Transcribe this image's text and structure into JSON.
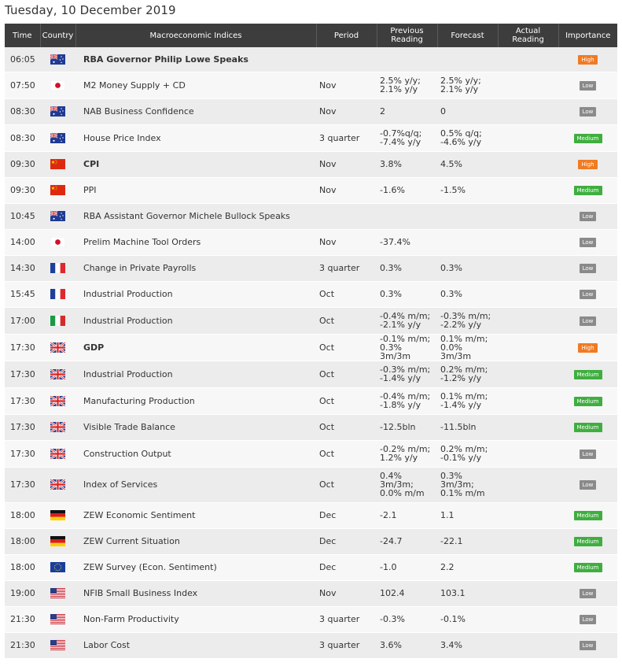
{
  "page_title": "Tuesday, 10 December 2019",
  "headers": [
    "Time",
    "Country",
    "Macroeconomic Indices",
    "Period",
    "Previous Reading",
    "Forecast",
    "Actual Reading",
    "Importance"
  ],
  "colors": {
    "header_bg": "#3d3d3d",
    "high": "#f07b23",
    "low": "#8a8a8a",
    "medium": "#3fae3f"
  },
  "rows": [
    {
      "time": "06:05",
      "country": "au",
      "flag_icon": "australia-flag-icon",
      "name": "RBA Governor Philip Lowe Speaks",
      "bold": true,
      "period": "",
      "previous": "",
      "forecast": "",
      "actual": "",
      "importance": "High"
    },
    {
      "time": "07:50",
      "country": "jp",
      "flag_icon": "japan-flag-icon",
      "name": "M2 Money Supply + CD",
      "bold": false,
      "period": "Nov",
      "previous": "2.5% y/y;\n2.1% y/y",
      "forecast": "2.5% y/y;\n2.1% y/y",
      "actual": "",
      "importance": "Low"
    },
    {
      "time": "08:30",
      "country": "au",
      "flag_icon": "australia-flag-icon",
      "name": "NAB Business Confidence",
      "bold": false,
      "period": "Nov",
      "previous": "2",
      "forecast": "0",
      "actual": "",
      "importance": "Low"
    },
    {
      "time": "08:30",
      "country": "au",
      "flag_icon": "australia-flag-icon",
      "name": "House Price Index",
      "bold": false,
      "period": "3 quarter",
      "previous": "-0.7%q/q;\n-7.4% y/y",
      "forecast": "0.5% q/q;\n-4.6% y/y",
      "actual": "",
      "importance": "Medium"
    },
    {
      "time": "09:30",
      "country": "cn",
      "flag_icon": "china-flag-icon",
      "name": "CPI",
      "bold": true,
      "period": "Nov",
      "previous": "3.8%",
      "forecast": "4.5%",
      "actual": "",
      "importance": "High"
    },
    {
      "time": "09:30",
      "country": "cn",
      "flag_icon": "china-flag-icon",
      "name": "PPI",
      "bold": false,
      "period": "Nov",
      "previous": "-1.6%",
      "forecast": "-1.5%",
      "actual": "",
      "importance": "Medium"
    },
    {
      "time": "10:45",
      "country": "au",
      "flag_icon": "australia-flag-icon",
      "name": "RBA Assistant Governor Michele Bullock Speaks",
      "bold": false,
      "period": "",
      "previous": "",
      "forecast": "",
      "actual": "",
      "importance": "Low"
    },
    {
      "time": "14:00",
      "country": "jp",
      "flag_icon": "japan-flag-icon",
      "name": "Prelim Machine Tool Orders",
      "bold": false,
      "period": "Nov",
      "previous": "-37.4%",
      "forecast": "",
      "actual": "",
      "importance": "Low"
    },
    {
      "time": "14:30",
      "country": "fr",
      "flag_icon": "france-flag-icon",
      "name": "Change in Private Payrolls",
      "bold": false,
      "period": "3 quarter",
      "previous": "0.3%",
      "forecast": "0.3%",
      "actual": "",
      "importance": "Low"
    },
    {
      "time": "15:45",
      "country": "fr",
      "flag_icon": "france-flag-icon",
      "name": "Industrial Production",
      "bold": false,
      "period": "Oct",
      "previous": "0.3%",
      "forecast": "0.3%",
      "actual": "",
      "importance": "Low"
    },
    {
      "time": "17:00",
      "country": "it",
      "flag_icon": "italy-flag-icon",
      "name": "Industrial Production",
      "bold": false,
      "period": "Oct",
      "previous": "-0.4% m/m;\n-2.1% y/y",
      "forecast": "-0.3% m/m;\n-2.2% y/y",
      "actual": "",
      "importance": "Low"
    },
    {
      "time": "17:30",
      "country": "uk",
      "flag_icon": "uk-flag-icon",
      "name": "GDP",
      "bold": true,
      "period": "Oct",
      "previous": "-0.1% m/m;\n0.3% 3m/3m",
      "forecast": "0.1% m/m;\n0.0% 3m/3m",
      "actual": "",
      "importance": "High"
    },
    {
      "time": "17:30",
      "country": "uk",
      "flag_icon": "uk-flag-icon",
      "name": "Industrial Production",
      "bold": false,
      "period": "Oct",
      "previous": "-0.3% m/m;\n-1.4% y/y",
      "forecast": "0.2% m/m;\n-1.2% y/y",
      "actual": "",
      "importance": "Medium"
    },
    {
      "time": "17:30",
      "country": "uk",
      "flag_icon": "uk-flag-icon",
      "name": "Manufacturing Production",
      "bold": false,
      "period": "Oct",
      "previous": "-0.4% m/m;\n-1.8% y/y",
      "forecast": "0.1% m/m;\n-1.4% y/y",
      "actual": "",
      "importance": "Medium"
    },
    {
      "time": "17:30",
      "country": "uk",
      "flag_icon": "uk-flag-icon",
      "name": "Visible Trade Balance",
      "bold": false,
      "period": "Oct",
      "previous": "-12.5bln",
      "forecast": "-11.5bln",
      "actual": "",
      "importance": "Medium"
    },
    {
      "time": "17:30",
      "country": "uk",
      "flag_icon": "uk-flag-icon",
      "name": "Construction Output",
      "bold": false,
      "period": "Oct",
      "previous": "-0.2% m/m;\n1.2% y/y",
      "forecast": "0.2% m/m;\n-0.1% y/y",
      "actual": "",
      "importance": "Low"
    },
    {
      "time": "17:30",
      "country": "uk",
      "flag_icon": "uk-flag-icon",
      "name": "Index of Services",
      "bold": false,
      "period": "Oct",
      "previous": "0.4%\n3m/3m;\n0.0% m/m",
      "forecast": "0.3%\n3m/3m;\n0.1% m/m",
      "actual": "",
      "importance": "Low"
    },
    {
      "time": "18:00",
      "country": "de",
      "flag_icon": "germany-flag-icon",
      "name": "ZEW Economic Sentiment",
      "bold": false,
      "period": "Dec",
      "previous": "-2.1",
      "forecast": "1.1",
      "actual": "",
      "importance": "Medium"
    },
    {
      "time": "18:00",
      "country": "de",
      "flag_icon": "germany-flag-icon",
      "name": "ZEW Current Situation",
      "bold": false,
      "period": "Dec",
      "previous": "-24.7",
      "forecast": "-22.1",
      "actual": "",
      "importance": "Medium"
    },
    {
      "time": "18:00",
      "country": "eu",
      "flag_icon": "eu-flag-icon",
      "name": "ZEW Survey (Econ. Sentiment)",
      "bold": false,
      "period": "Dec",
      "previous": "-1.0",
      "forecast": "2.2",
      "actual": "",
      "importance": "Medium"
    },
    {
      "time": "19:00",
      "country": "us",
      "flag_icon": "usa-flag-icon",
      "name": "NFIB Small Business Index",
      "bold": false,
      "period": "Nov",
      "previous": "102.4",
      "forecast": "103.1",
      "actual": "",
      "importance": "Low"
    },
    {
      "time": "21:30",
      "country": "us",
      "flag_icon": "usa-flag-icon",
      "name": "Non-Farm Productivity",
      "bold": false,
      "period": "3 quarter",
      "previous": "-0.3%",
      "forecast": "-0.1%",
      "actual": "",
      "importance": "Low"
    },
    {
      "time": "21:30",
      "country": "us",
      "flag_icon": "usa-flag-icon",
      "name": "Labor Cost",
      "bold": false,
      "period": "3 quarter",
      "previous": "3.6%",
      "forecast": "3.4%",
      "actual": "",
      "importance": "Low"
    }
  ]
}
